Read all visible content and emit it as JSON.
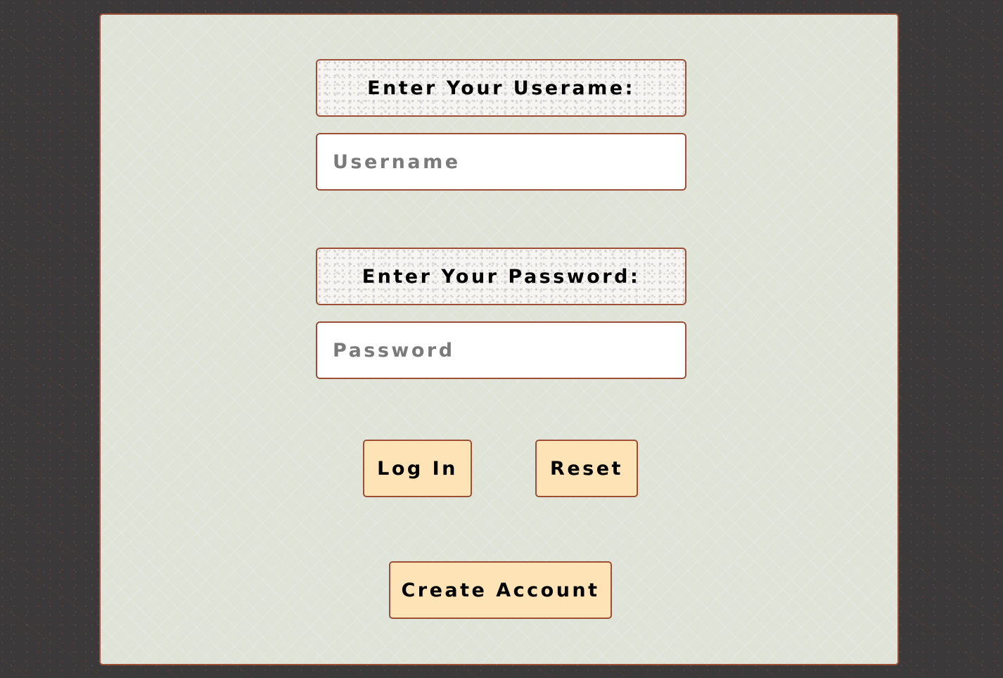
{
  "login_form": {
    "username_label": "Enter Your Userame:",
    "username_placeholder": "Username",
    "username_value": "",
    "password_label": "Enter Your Password:",
    "password_placeholder": "Password",
    "password_value": "",
    "login_button": "Log In",
    "reset_button": "Reset",
    "create_account_button": "Create Account"
  },
  "colors": {
    "page_background": "#3b393a",
    "panel_background": "#dfe3d8",
    "border": "#9c4f34",
    "button_background": "#fde3b5",
    "input_background": "#ffffff"
  }
}
